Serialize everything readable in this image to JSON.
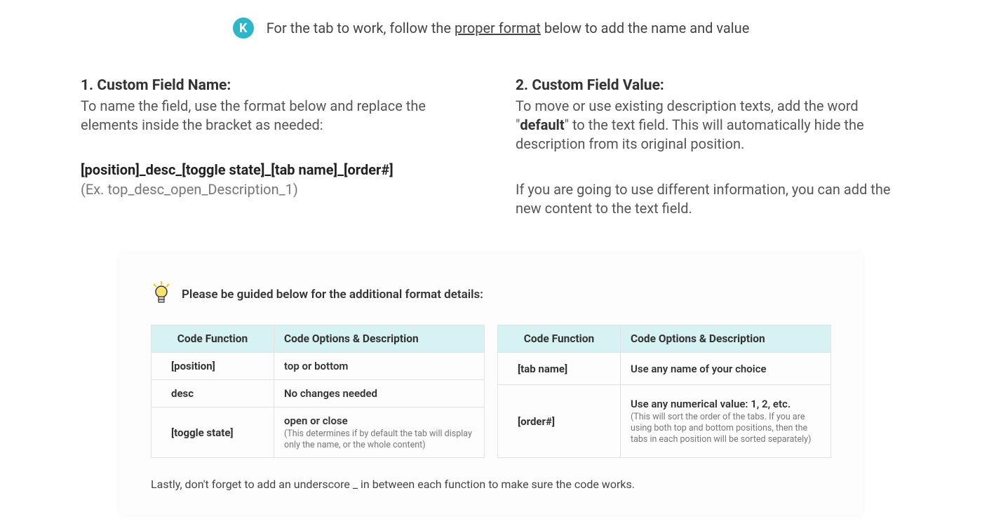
{
  "banner": {
    "badge": "K",
    "text_before": "For the tab to work, follow the ",
    "text_underlined": "proper format",
    "text_after": " below to add the name and value"
  },
  "section1": {
    "title": "1. Custom Field Name:",
    "intro": "To name the field, use the format below and replace the elements inside the bracket as needed:",
    "pattern": "[position]_desc_[toggle state]_[tab name]_[order#]",
    "example": "(Ex. top_desc_open_Description_1)"
  },
  "section2": {
    "title": "2. Custom Field Value:",
    "para1_before": "To move or use existing description texts, add the word \"",
    "para1_bold": "default",
    "para1_after": "\" to the text field. This will automatically hide the description from its original position.",
    "para2": "If you are going to use different information, you can add the new content to the text field."
  },
  "guide": {
    "header": "Please be guided below for the additional format details:",
    "table_left": {
      "head": [
        "Code Function",
        "Code Options & Description"
      ],
      "rows": [
        {
          "fn": "[position]",
          "desc": "top or bottom",
          "sub": ""
        },
        {
          "fn": "desc",
          "desc": "No changes needed",
          "sub": ""
        },
        {
          "fn": "[toggle state]",
          "desc": "open or close",
          "sub": "(This determines if by default the tab will display only the name, or the whole content)"
        }
      ]
    },
    "table_right": {
      "head": [
        "Code Function",
        "Code Options & Description"
      ],
      "rows": [
        {
          "fn": "[tab name]",
          "desc": "Use any name of your choice",
          "sub": ""
        },
        {
          "fn": "[order#]",
          "desc": "Use any numerical value: 1, 2, etc.",
          "sub": "(This will sort the order of the tabs. If you are using both top and bottom positions, then the tabs in each position will be sorted separately)"
        }
      ]
    },
    "footer": "Lastly, don't forget to add an underscore _ in between each function to make sure the code works."
  }
}
